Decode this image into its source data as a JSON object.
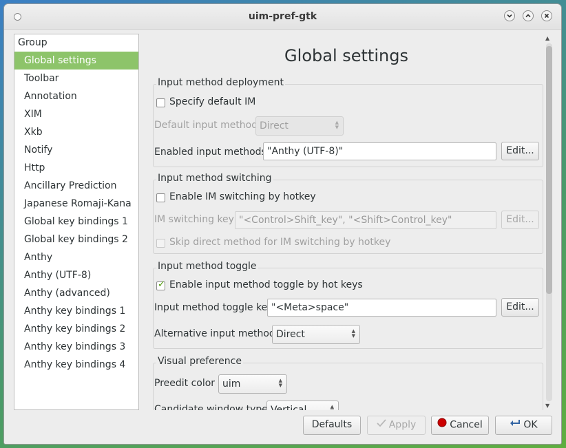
{
  "window": {
    "title": "uim-pref-gtk"
  },
  "sidebar": {
    "header": "Group",
    "items": [
      {
        "label": "Global settings"
      },
      {
        "label": "Toolbar"
      },
      {
        "label": "Annotation"
      },
      {
        "label": "XIM"
      },
      {
        "label": "Xkb"
      },
      {
        "label": "Notify"
      },
      {
        "label": "Http"
      },
      {
        "label": "Ancillary Prediction"
      },
      {
        "label": "Japanese Romaji-Kana"
      },
      {
        "label": "Global key bindings 1"
      },
      {
        "label": "Global key bindings 2"
      },
      {
        "label": "Anthy"
      },
      {
        "label": "Anthy (UTF-8)"
      },
      {
        "label": "Anthy (advanced)"
      },
      {
        "label": "Anthy key bindings 1"
      },
      {
        "label": "Anthy key bindings 2"
      },
      {
        "label": "Anthy key bindings 3"
      },
      {
        "label": "Anthy key bindings 4"
      }
    ]
  },
  "main": {
    "title": "Global settings",
    "deployment": {
      "label": "Input method deployment",
      "specify_default": "Specify default IM",
      "default_im_label": "Default input method",
      "default_im_value": "Direct",
      "enabled_label": "Enabled input methods",
      "enabled_value": "\"Anthy (UTF-8)\"",
      "edit": "Edit..."
    },
    "switching": {
      "label": "Input method switching",
      "enable_hotkey": "Enable IM switching by hotkey",
      "key_label": "IM switching key",
      "key_value": "\"<Control>Shift_key\", \"<Shift>Control_key\"",
      "edit": "Edit...",
      "skip_direct": "Skip direct method for IM switching by hotkey"
    },
    "toggle": {
      "label": "Input method toggle",
      "enable_toggle": "Enable input method toggle by hot keys",
      "toggle_key_label": "Input method toggle key",
      "toggle_key_value": "\"<Meta>space\"",
      "edit": "Edit...",
      "alt_label": "Alternative input method",
      "alt_value": "Direct"
    },
    "visual": {
      "label": "Visual preference",
      "preedit_label": "Preedit color",
      "preedit_value": "uim",
      "candidate_label": "Candidate window type",
      "candidate_value": "Vertical"
    }
  },
  "buttons": {
    "defaults": "Defaults",
    "apply": "Apply",
    "cancel": "Cancel",
    "ok": "OK"
  },
  "colors": {
    "selection": "#8dc46a",
    "cancel_red": "#cc0000"
  }
}
